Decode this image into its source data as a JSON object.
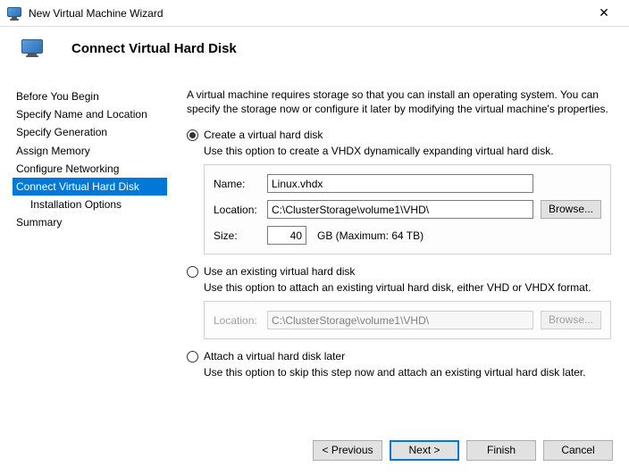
{
  "window": {
    "title": "New Virtual Machine Wizard"
  },
  "page": {
    "heading": "Connect Virtual Hard Disk"
  },
  "sidebar": {
    "items": [
      {
        "label": "Before You Begin"
      },
      {
        "label": "Specify Name and Location"
      },
      {
        "label": "Specify Generation"
      },
      {
        "label": "Assign Memory"
      },
      {
        "label": "Configure Networking"
      },
      {
        "label": "Connect Virtual Hard Disk"
      },
      {
        "label": "Installation Options"
      },
      {
        "label": "Summary"
      }
    ],
    "selected_index": 5,
    "sub_index": 6
  },
  "intro": "A virtual machine requires storage so that you can install an operating system. You can specify the storage now or configure it later by modifying the virtual machine's properties.",
  "options": {
    "create": {
      "label": "Create a virtual hard disk",
      "desc": "Use this option to create a VHDX dynamically expanding virtual hard disk.",
      "name_label": "Name:",
      "name_value": "Linux.vhdx",
      "location_label": "Location:",
      "location_value": "C:\\ClusterStorage\\volume1\\VHD\\",
      "browse_label": "Browse...",
      "size_label": "Size:",
      "size_value": "40",
      "size_unit": "GB (Maximum: 64 TB)"
    },
    "existing": {
      "label": "Use an existing virtual hard disk",
      "desc": "Use this option to attach an existing virtual hard disk, either VHD or VHDX format.",
      "location_label": "Location:",
      "location_value": "C:\\ClusterStorage\\volume1\\VHD\\",
      "browse_label": "Browse..."
    },
    "later": {
      "label": "Attach a virtual hard disk later",
      "desc": "Use this option to skip this step now and attach an existing virtual hard disk later."
    },
    "selected": "create"
  },
  "buttons": {
    "previous": "< Previous",
    "next": "Next >",
    "finish": "Finish",
    "cancel": "Cancel"
  }
}
